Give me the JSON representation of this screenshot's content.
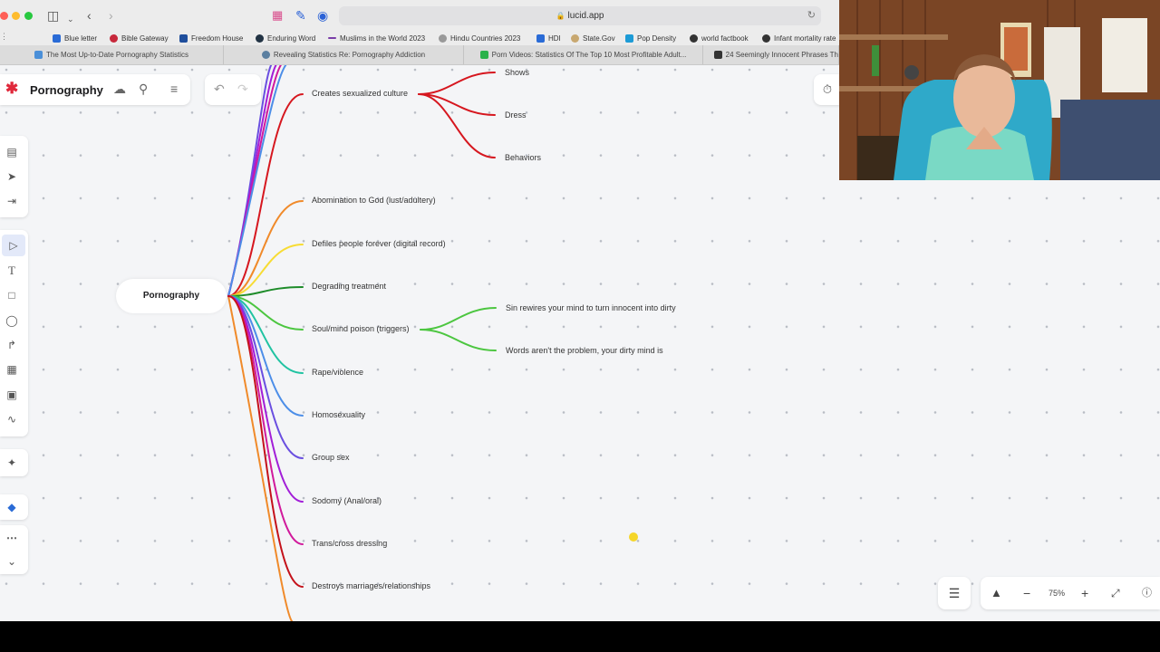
{
  "browser": {
    "url": "lucid.app",
    "bookmarks": [
      {
        "label": "Blue letter",
        "icon": "bookmark-icon",
        "color": "#2a6bd6"
      },
      {
        "label": "Bible Gateway",
        "icon": "bible-icon",
        "color": "#c7283b"
      },
      {
        "label": "Freedom House",
        "icon": "freedom-house-icon",
        "color": "#1f4e9c"
      },
      {
        "label": "Enduring Word",
        "icon": "enduring-word-icon",
        "color": "#234"
      },
      {
        "label": "Muslims in the World 2023",
        "icon": "minus-icon",
        "color": "#7a3ea8"
      },
      {
        "label": "Hindu Countries 2023",
        "icon": "globe-icon",
        "color": "#777"
      },
      {
        "label": "HDI",
        "icon": "doc-icon",
        "color": "#2a6bd6"
      },
      {
        "label": "State.Gov",
        "icon": "state-icon",
        "color": "#c8a870"
      },
      {
        "label": "Pop Density",
        "icon": "pop-icon",
        "color": "#1d9bd6"
      },
      {
        "label": "world factbook",
        "icon": "factbook-icon",
        "color": "#333"
      },
      {
        "label": "Infant mortality rate",
        "icon": "infant-icon",
        "color": "#333"
      }
    ],
    "tabs": [
      {
        "label": "The Most Up-to-Date Pornography Statistics",
        "color": "#4a8fd8"
      },
      {
        "label": "Revealing Statistics Re: Pornography Addiction",
        "color": "#5b7fa0"
      },
      {
        "label": "Porn Videos: Statistics Of The Top 10 Most Profitable Adult...",
        "color": "#2ab24b"
      },
      {
        "label": "24 Seemingly Innocent Phrases Th",
        "color": "#333"
      }
    ]
  },
  "doc": {
    "title": "Pornography"
  },
  "mindmap": {
    "central": "Pornography",
    "branches": [
      {
        "label": "Creates sexualized culture",
        "color": "#d6171f"
      },
      {
        "label": "Abomination to God (lust/adultery)",
        "color": "#f08a2a"
      },
      {
        "label": "Defiles people forever (digital record)",
        "color": "#f7dc34"
      },
      {
        "label": "Degrading treatment",
        "color": "#1e8c2a"
      },
      {
        "label": "Soul/mind poison (triggers)",
        "color": "#4cc640"
      },
      {
        "label": "Rape/violence",
        "color": "#21c3a2"
      },
      {
        "label": "Homosexuality",
        "color": "#4c8ee8"
      },
      {
        "label": "Group sex",
        "color": "#6a4fe0"
      },
      {
        "label": "Sodomy (Anal/oral)",
        "color": "#a21ed8"
      },
      {
        "label": "Trans/cross dressing",
        "color": "#d11a9c"
      },
      {
        "label": "Destroys marriages/relationships",
        "color": "#c4121b"
      }
    ],
    "culture_children": [
      "Shows",
      "Dress",
      "Behaviors"
    ],
    "poison_children": [
      "Sin rewires your mind to turn innocent into dirty",
      "Words aren't the problem, your dirty mind is"
    ]
  },
  "zoom": {
    "level": "75%"
  }
}
